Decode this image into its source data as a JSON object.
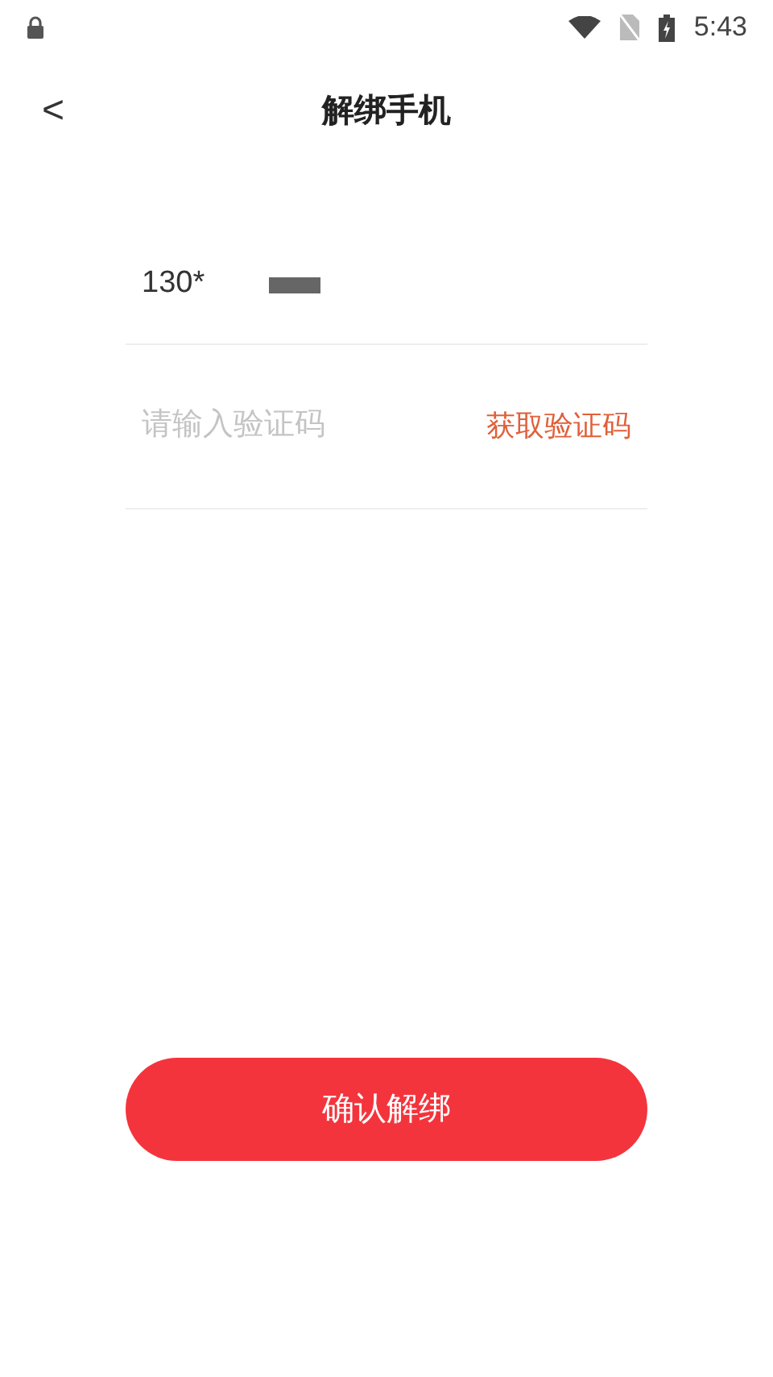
{
  "status_bar": {
    "time": "5:43"
  },
  "header": {
    "back": "<",
    "title": "解绑手机"
  },
  "phone": {
    "value": "130*",
    "redacted": true
  },
  "code_field": {
    "placeholder": "请输入验证码",
    "get_code": "获取验证码"
  },
  "confirm_button": "确认解绑"
}
